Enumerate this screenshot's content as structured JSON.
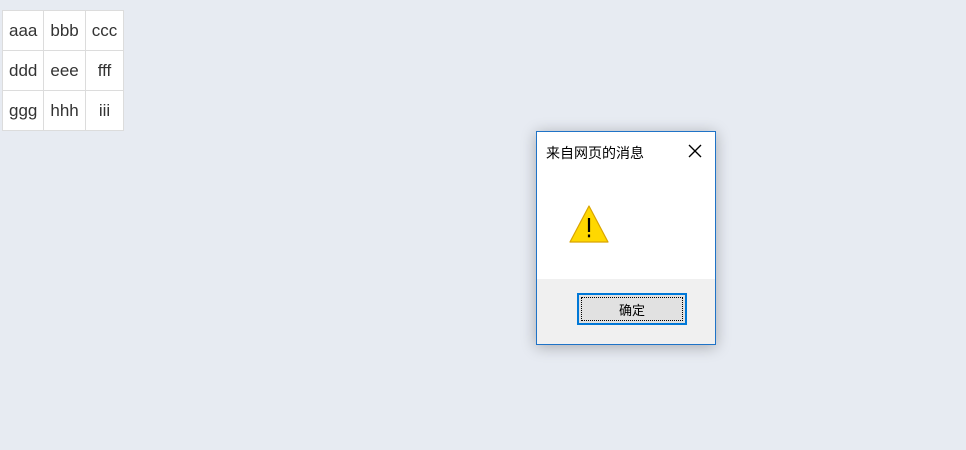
{
  "table": {
    "rows": [
      [
        "aaa",
        "bbb",
        "ccc"
      ],
      [
        "ddd",
        "eee",
        "fff"
      ],
      [
        "ggg",
        "hhh",
        "iii"
      ]
    ]
  },
  "dialog": {
    "title": "来自网页的消息",
    "icon": "warning-icon",
    "message": "",
    "ok_label": "确定",
    "close_icon": "close-icon"
  },
  "colors": {
    "page_background": "#e7ebf2",
    "dialog_border": "#1f73c7",
    "button_focus": "#0078d7",
    "warning_fill": "#ffd800"
  }
}
